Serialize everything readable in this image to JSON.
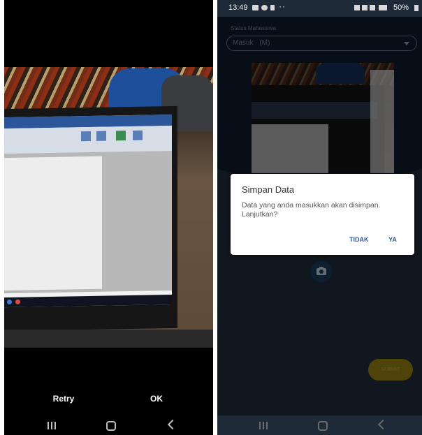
{
  "left_panel": {
    "buttons": {
      "retry": "Retry",
      "ok": "OK"
    }
  },
  "right_panel": {
    "status_bar": {
      "time": "13:49",
      "overflow": "··",
      "battery": "50%"
    },
    "form": {
      "label": "Status Mahasiswa",
      "selected_value": "Masuk · (M)",
      "submit_label": "SUBMIT"
    },
    "dialog": {
      "title": "Simpan Data",
      "message": "Data yang anda masukkan akan disimpan. Lanjutkan?",
      "cancel_label": "TIDAK",
      "confirm_label": "YA"
    }
  },
  "navigation": {
    "icons": [
      "recent-apps-icon",
      "home-icon",
      "back-icon"
    ]
  },
  "colors": {
    "app_background": "#0d1a2b",
    "dialog_button": "#2e5d98",
    "submit_button": "#8f7b10"
  }
}
